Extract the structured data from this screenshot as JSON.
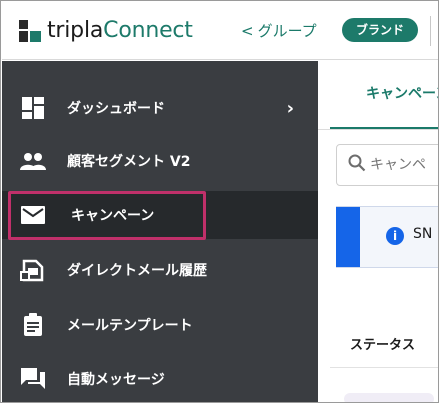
{
  "header": {
    "logo_prefix": "tripla",
    "logo_suffix": "Connect",
    "breadcrumb_chevron": "<",
    "breadcrumb_label": "グループ",
    "brand_badge": "ブランド"
  },
  "sidebar": {
    "items": [
      {
        "label": "ダッシュボード",
        "icon": "dashboard-icon",
        "chevron": "›"
      },
      {
        "label": "顧客セグメント V2",
        "icon": "people-icon"
      },
      {
        "label": "キャンペーン",
        "icon": "mail-icon"
      },
      {
        "label": "ダイレクトメール履歴",
        "icon": "mail-history-icon"
      },
      {
        "label": "メールテンプレート",
        "icon": "clipboard-icon"
      },
      {
        "label": "自動メッセージ",
        "icon": "chat-icon"
      }
    ]
  },
  "main": {
    "tab_label": "キャンペーン",
    "search_placeholder": "キャンペ",
    "notice_text": "SN",
    "notice_info_symbol": "i",
    "column_header": "ステータス"
  },
  "colors": {
    "accent": "#1d7a6a",
    "sidebar_bg": "#3a3d41",
    "highlight": "#c0306a",
    "notice_blue": "#1565e8"
  }
}
